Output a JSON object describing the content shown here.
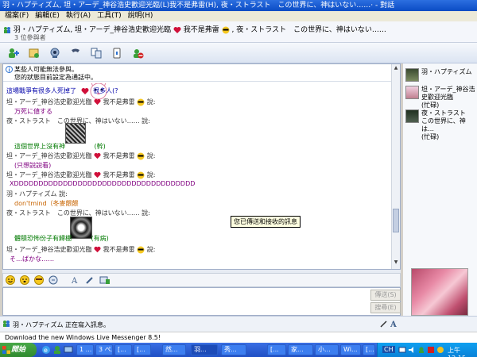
{
  "window": {
    "title": "羽・ハプティズム, 坦・アーデ_神谷浩史歡迎光臨(L)我不是弗雷(H), 夜・ストラスト　この世界に、神はいない……· - 對話"
  },
  "menu": [
    "檔案(F)",
    "編輯(E)",
    "執行(A)",
    "工具(T)",
    "說明(H)"
  ],
  "header": {
    "participants_line": "羽・ハプティズム, 坦・アーデ_神谷浩史歡迎光臨",
    "participants_line2": "我不是弗雷",
    "participants_line3": ", 夜・ストラスト　この世界に、神はいない……",
    "count": "3 位參與者"
  },
  "toolbar": [
    "invite-icon",
    "share-files-icon",
    "video-icon",
    "call-icon",
    "activities-icon",
    "games-icon",
    "block-icon"
  ],
  "info": {
    "line1": "某些人可能無法參與。",
    "line2": "您的狀態目前設定為通話中。"
  },
  "chat": [
    {
      "type": "msg",
      "cls": "blue",
      "text": "這場戰爭有很多人死掉了",
      "extra": "很多人(?"
    },
    {
      "type": "name",
      "text": "坦・アーデ_神谷浩史歡迎光臨",
      "suffix": "我不是弗雷",
      "tail": "說:"
    },
    {
      "type": "msg",
      "cls": "purple",
      "text": "万死に値する"
    },
    {
      "type": "name",
      "text": "夜・ストラスト　この世界に、神はいない……",
      "tail": "說:"
    },
    {
      "type": "msg",
      "cls": "green",
      "text": "這個世界上沒有神",
      "extra": "(幹)"
    },
    {
      "type": "name",
      "text": "坦・アーデ_神谷浩史歡迎光臨",
      "suffix": "我不是弗雷",
      "tail": "說:"
    },
    {
      "type": "msg",
      "cls": "purple",
      "text": "(只想說說看)"
    },
    {
      "type": "name",
      "text": "坦・アーデ_神谷浩史歡迎光臨",
      "suffix": "我不是弗雷",
      "tail": "說:"
    },
    {
      "type": "msg",
      "cls": "purple",
      "text": "XDDDDDDDDDDDDDDDDDDDDDDDDDDDDDDDDDDDDD"
    },
    {
      "type": "name",
      "text": "羽・ハプティズム",
      "tail": "說:"
    },
    {
      "type": "msg",
      "cls": "orange",
      "text": "don'tmind（冬麥餵餵"
    },
    {
      "type": "name",
      "text": "夜・ストラスト　この世界に、神はいない……",
      "tail": "說:"
    },
    {
      "type": "msg",
      "cls": "green",
      "text": "體積恐怖份子有歸棚",
      "extra": "(有病)"
    },
    {
      "type": "name",
      "text": "坦・アーデ_神谷浩史歡迎光臨",
      "suffix": "我不是弗雷",
      "tail": "說:"
    },
    {
      "type": "msg",
      "cls": "purple",
      "text": "そ…ばかな……"
    }
  ],
  "tooltip": "您已傳送和接收的訊息",
  "input": {
    "send_label": "傳送(S)",
    "search_label": "搜尋(E)"
  },
  "right_panel": {
    "participants": [
      {
        "name": "羽・ハプティズム"
      },
      {
        "name": "坦・アーデ_神谷浩史歡迎光臨",
        "status": "(忙碌)"
      },
      {
        "name": "夜・ストラスト　この世界に、神は…",
        "status": "(忙碌)"
      }
    ]
  },
  "statusbar": {
    "typing": "羽・ハプティズム 正在寫入訊息。"
  },
  "download": "Download the new Windows Live Messenger 8.5!",
  "taskbar": {
    "start": "開始",
    "tasks": [
      "1 ...",
      "3 ぺ...",
      "[...",
      "[...",
      "然...",
      "羽...",
      "秀...",
      "[...",
      "家...",
      "小...",
      "Wi...",
      "[..."
    ],
    "lang": "CH",
    "clock": "上午 12:15"
  },
  "colors": {
    "heart": "#d0103a",
    "blue_text": "#0000aa",
    "green_text": "#007a00",
    "purple_text": "#800080",
    "orange_text": "#c86400"
  }
}
